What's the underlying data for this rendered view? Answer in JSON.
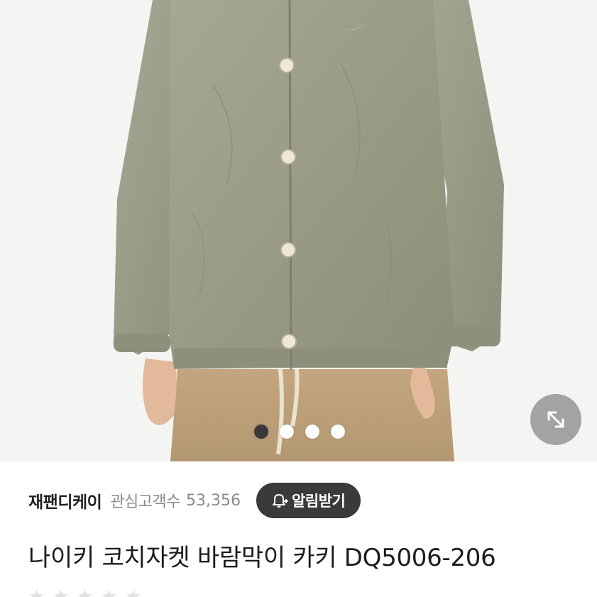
{
  "seller": {
    "name": "재팬디케이",
    "follower_label": "관심고객수",
    "follower_count": "53,356",
    "alert_button_label": "알림받기"
  },
  "product": {
    "title": "나이키 코치자켓 바람막이 카키 DQ5006-206"
  },
  "gallery": {
    "total_images": 4,
    "current_index": 1
  },
  "icons": {
    "expand": "expand-arrows-icon",
    "bell": "bell-plus-icon",
    "rating": "star-icon"
  },
  "colors": {
    "jacket": "#9a9b87",
    "pants": "#bfa27b",
    "button_dark": "#3a3a3c",
    "muted_text": "#8a8a8e"
  }
}
